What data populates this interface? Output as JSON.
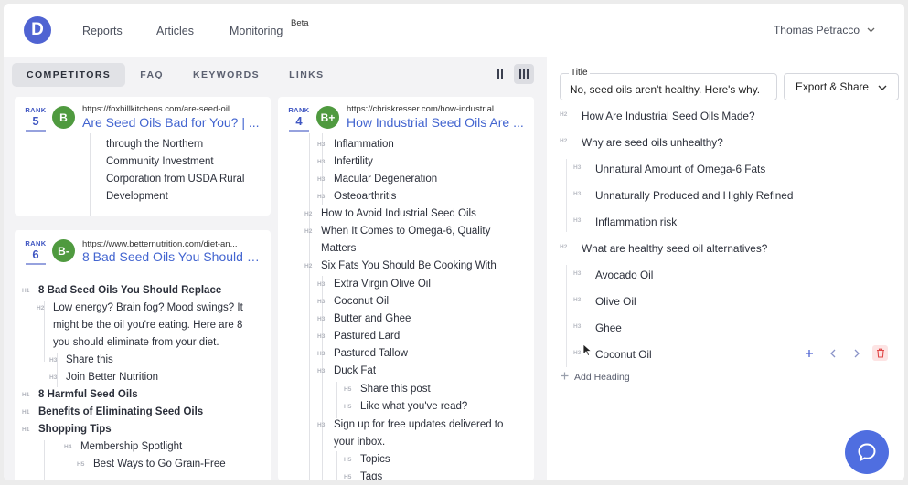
{
  "app": {
    "logo_letter": "D"
  },
  "nav": {
    "reports": "Reports",
    "articles": "Articles",
    "monitoring": "Monitoring",
    "beta": "Beta"
  },
  "user": {
    "name": "Thomas Petracco"
  },
  "tabs": [
    "COMPETITORS",
    "FAQ",
    "KEYWORDS",
    "LINKS"
  ],
  "competitors": [
    {
      "rank_label": "RANK",
      "rank": "5",
      "grade": "B",
      "grade_color": "#4f9a3f",
      "url": "https://foxhillkitchens.com/are-seed-oil...",
      "title": "Are Seed Oils Bad for You? | ...",
      "headings": [
        {
          "tag": "",
          "text": "through the Northern"
        },
        {
          "tag": "",
          "text": "Community Investment"
        },
        {
          "tag": "",
          "text": "Corporation from USDA Rural"
        },
        {
          "tag": "",
          "text": "Development"
        }
      ]
    },
    {
      "rank_label": "RANK",
      "rank": "4",
      "grade": "B+",
      "grade_color": "#4f9a3f",
      "url": "https://chriskresser.com/how-industrial...",
      "title": "How Industrial Seed Oils Are ...",
      "headings": [
        {
          "tag": "H3",
          "text": "Inflammation"
        },
        {
          "tag": "H3",
          "text": "Infertility"
        },
        {
          "tag": "H3",
          "text": "Macular Degeneration"
        },
        {
          "tag": "H3",
          "text": "Osteoarthritis"
        },
        {
          "tag": "H2",
          "text": "How to Avoid Industrial Seed Oils"
        },
        {
          "tag": "H2",
          "text": "When It Comes to Omega-6, Quality"
        },
        {
          "tag": "",
          "text": "Matters"
        },
        {
          "tag": "H2",
          "text": "Six Fats You Should Be Cooking With"
        },
        {
          "tag": "H3",
          "text": "Extra Virgin Olive Oil"
        },
        {
          "tag": "H3",
          "text": "Coconut Oil"
        },
        {
          "tag": "H3",
          "text": "Butter and Ghee"
        },
        {
          "tag": "H3",
          "text": "Pastured Lard"
        },
        {
          "tag": "H3",
          "text": "Pastured Tallow"
        },
        {
          "tag": "H3",
          "text": "Duck Fat"
        },
        {
          "tag": "H5",
          "text": "Share this post"
        },
        {
          "tag": "H5",
          "text": "Like what you've read?"
        },
        {
          "tag": "H3",
          "text": "Sign up for free updates delivered to"
        },
        {
          "tag": "",
          "text": "your inbox."
        },
        {
          "tag": "H5",
          "text": "Topics"
        },
        {
          "tag": "H5",
          "text": "Tags"
        }
      ]
    },
    {
      "rank_label": "RANK",
      "rank": "6",
      "grade": "B-",
      "grade_color": "#4f9a3f",
      "url": "https://www.betternutrition.com/diet-an...",
      "title": "8 Bad Seed Oils You Should E...",
      "headings": [
        {
          "tag": "H1",
          "text": "8 Bad Seed Oils You Should Replace"
        },
        {
          "tag": "H2",
          "text": "Low energy? Brain fog? Mood swings? It"
        },
        {
          "tag": "",
          "text": "might be the oil you're eating. Here are 8"
        },
        {
          "tag": "",
          "text": "you should eliminate from your diet."
        },
        {
          "tag": "H3",
          "text": "Share this"
        },
        {
          "tag": "H3",
          "text": "Join Better Nutrition"
        },
        {
          "tag": "H1",
          "text": "8 Harmful Seed Oils"
        },
        {
          "tag": "H1",
          "text": "Benefits of Eliminating Seed Oils"
        },
        {
          "tag": "H1",
          "text": "Shopping Tips"
        },
        {
          "tag": "H4",
          "text": "Membership Spotlight"
        },
        {
          "tag": "H5",
          "text": "Best Ways to Go Grain-Free"
        }
      ]
    }
  ],
  "editor": {
    "title_label": "Title",
    "title_value": "No, seed oils aren't healthy. Here's why.",
    "export_label": "Export & Share",
    "outline": [
      {
        "tag": "H2",
        "text": "How Are Industrial Seed Oils Made?"
      },
      {
        "tag": "H2",
        "text": "Why are seed oils unhealthy?"
      },
      {
        "tag": "H3",
        "text": "Unnatural Amount of Omega-6 Fats"
      },
      {
        "tag": "H3",
        "text": "Unnaturally Produced and Highly Refined"
      },
      {
        "tag": "H3",
        "text": "Inflammation risk"
      },
      {
        "tag": "H2",
        "text": "What are healthy seed oil alternatives?"
      },
      {
        "tag": "H3",
        "text": "Avocado Oil"
      },
      {
        "tag": "H3",
        "text": "Olive Oil"
      },
      {
        "tag": "H3",
        "text": "Ghee"
      },
      {
        "tag": "H3",
        "text": "Coconut Oil"
      }
    ],
    "add_heading": "Add Heading"
  },
  "colors": {
    "accent": "#4f63d2",
    "grade_green": "#4f9a3f",
    "delete_red": "#e04848"
  }
}
